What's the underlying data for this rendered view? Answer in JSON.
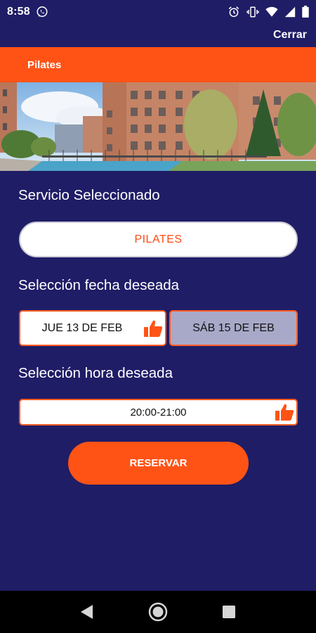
{
  "status_bar": {
    "time": "8:58",
    "icons": [
      "whatsapp-icon",
      "alarm-icon",
      "vibrate-icon",
      "wifi-icon",
      "signal-icon",
      "battery-icon"
    ]
  },
  "header": {
    "close_label": "Cerrar",
    "title": "Pilates"
  },
  "hero": {
    "image_description": ""
  },
  "service": {
    "label": "Servicio Seleccionado",
    "value": "PILATES"
  },
  "date": {
    "label": "Selección fecha deseada",
    "options": [
      {
        "label": "JUE 13 DE FEB",
        "selected": true
      },
      {
        "label": "SÁB 15 DE FEB",
        "selected": false
      }
    ]
  },
  "time": {
    "label": "Selección hora deseada",
    "slot": "20:00-21:00",
    "selected": true
  },
  "actions": {
    "reserve_label": "RESERVAR"
  },
  "nav": {
    "icons": [
      "back-icon",
      "home-icon",
      "recents-icon"
    ]
  },
  "colors": {
    "background": "#1f1d66",
    "accent": "#ff5316",
    "selected_date_bg": "#ffffff",
    "unselected_date_bg": "#a8a8c8"
  }
}
